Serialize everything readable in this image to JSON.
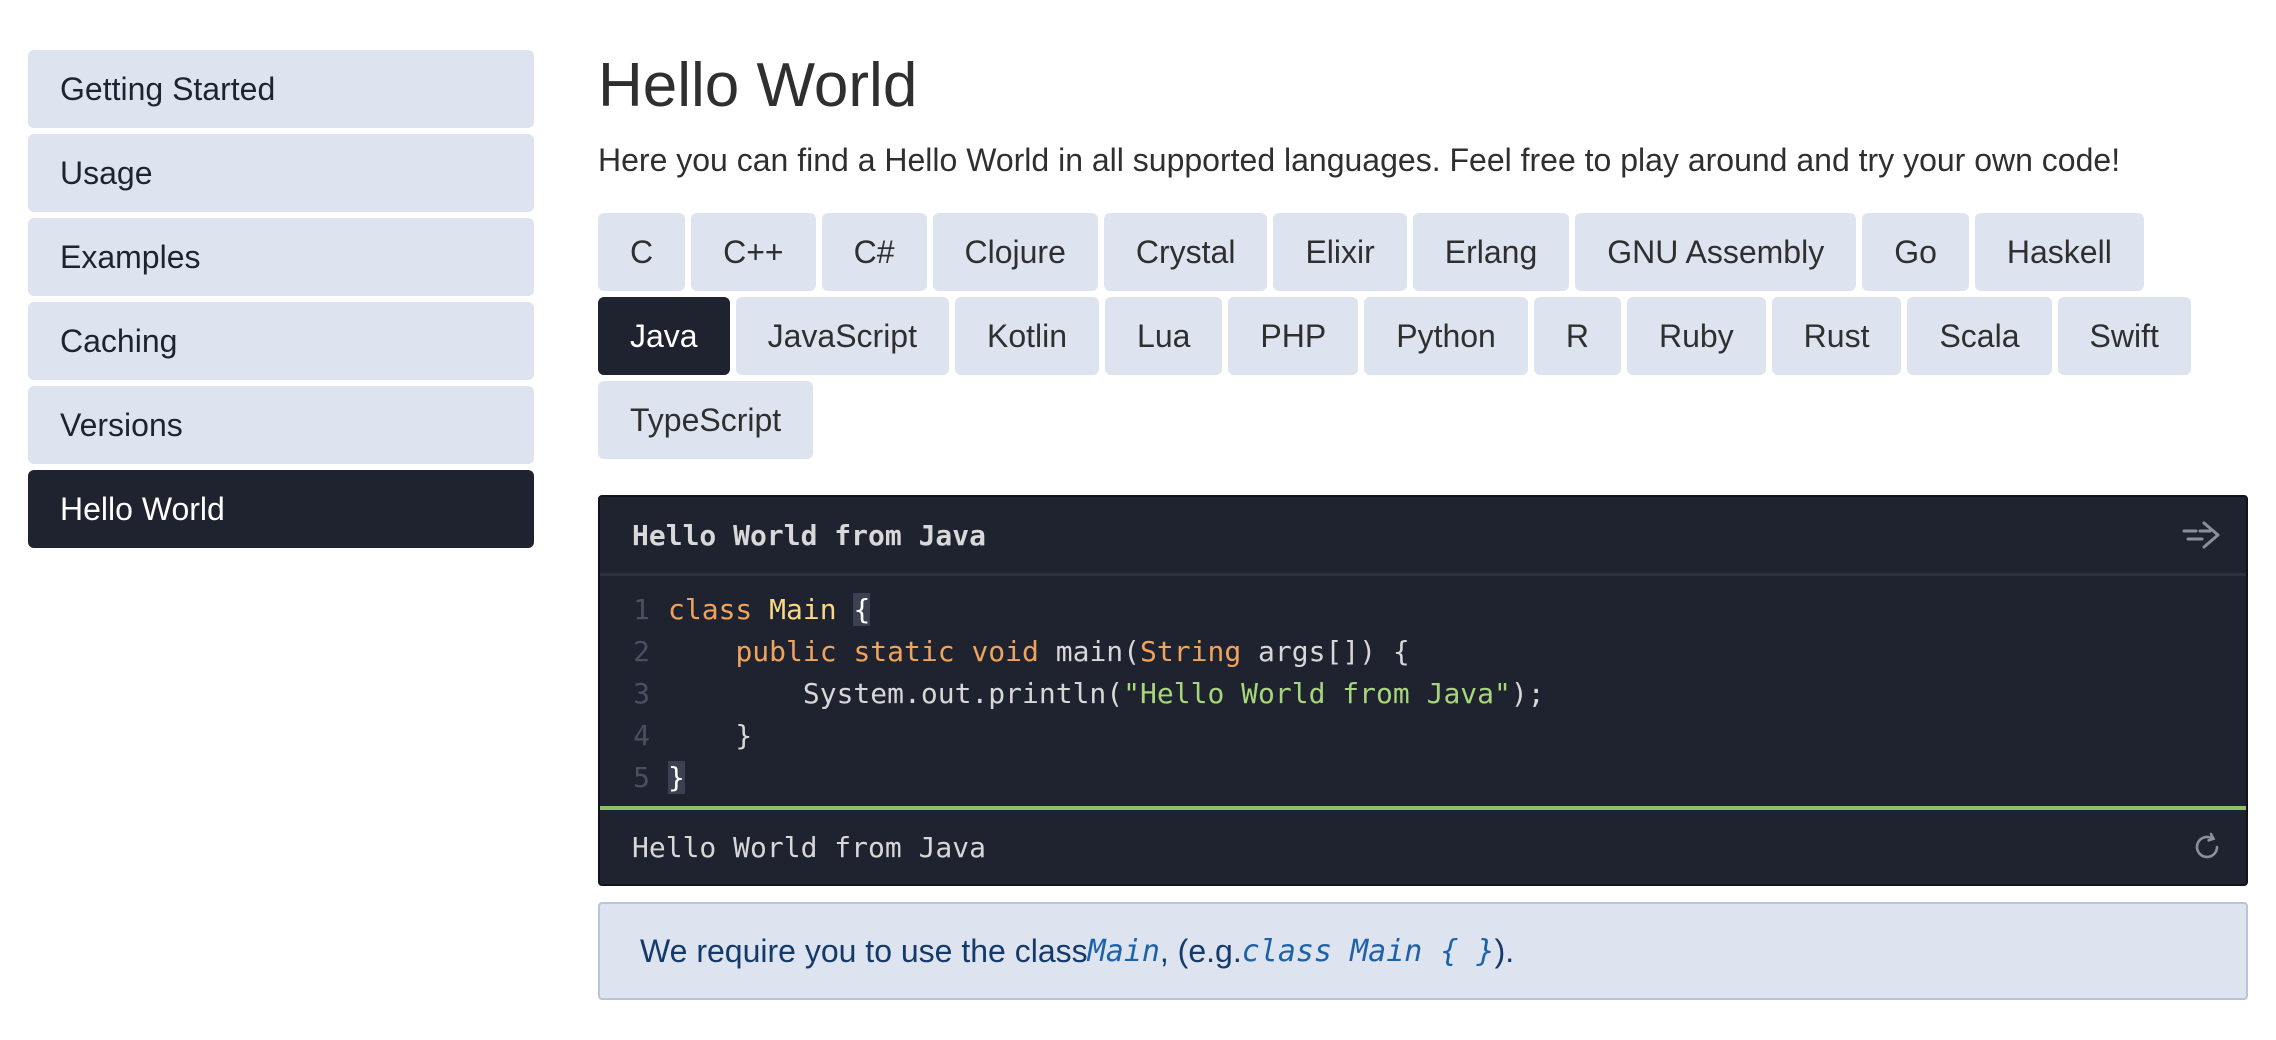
{
  "sidebar": {
    "items": [
      {
        "label": "Getting Started",
        "active": false
      },
      {
        "label": "Usage",
        "active": false
      },
      {
        "label": "Examples",
        "active": false
      },
      {
        "label": "Caching",
        "active": false
      },
      {
        "label": "Versions",
        "active": false
      },
      {
        "label": "Hello World",
        "active": true
      }
    ]
  },
  "main": {
    "title": "Hello World",
    "intro": "Here you can find a Hello World in all supported languages. Feel free to play around and try your own code!",
    "languages": [
      {
        "label": "C",
        "active": false
      },
      {
        "label": "C++",
        "active": false
      },
      {
        "label": "C#",
        "active": false
      },
      {
        "label": "Clojure",
        "active": false
      },
      {
        "label": "Crystal",
        "active": false
      },
      {
        "label": "Elixir",
        "active": false
      },
      {
        "label": "Erlang",
        "active": false
      },
      {
        "label": "GNU Assembly",
        "active": false
      },
      {
        "label": "Go",
        "active": false
      },
      {
        "label": "Haskell",
        "active": false
      },
      {
        "label": "Java",
        "active": true
      },
      {
        "label": "JavaScript",
        "active": false
      },
      {
        "label": "Kotlin",
        "active": false
      },
      {
        "label": "Lua",
        "active": false
      },
      {
        "label": "PHP",
        "active": false
      },
      {
        "label": "Python",
        "active": false
      },
      {
        "label": "R",
        "active": false
      },
      {
        "label": "Ruby",
        "active": false
      },
      {
        "label": "Rust",
        "active": false
      },
      {
        "label": "Scala",
        "active": false
      },
      {
        "label": "Swift",
        "active": false
      },
      {
        "label": "TypeScript",
        "active": false
      }
    ],
    "editor": {
      "title": "Hello World from Java",
      "run_icon": "run-arrow-icon",
      "reset_icon": "refresh-icon",
      "lines": [
        {
          "num": "1",
          "tokens": [
            {
              "t": "class ",
              "c": "kw"
            },
            {
              "t": "Main",
              "c": "cls"
            },
            {
              "t": " ",
              "c": "plain"
            },
            {
              "t": "{",
              "c": "brace-hl"
            }
          ]
        },
        {
          "num": "2",
          "tokens": [
            {
              "t": "    ",
              "c": "plain"
            },
            {
              "t": "public static void ",
              "c": "kw"
            },
            {
              "t": "main(",
              "c": "plain"
            },
            {
              "t": "String",
              "c": "kw"
            },
            {
              "t": " args[]) {",
              "c": "plain"
            }
          ]
        },
        {
          "num": "3",
          "tokens": [
            {
              "t": "        System.out.println(",
              "c": "plain"
            },
            {
              "t": "\"Hello World from Java\"",
              "c": "str"
            },
            {
              "t": ");",
              "c": "plain"
            }
          ]
        },
        {
          "num": "4",
          "tokens": [
            {
              "t": "    }",
              "c": "plain"
            }
          ]
        },
        {
          "num": "5",
          "tokens": [
            {
              "t": "}",
              "c": "brace-hl"
            }
          ]
        }
      ],
      "output": "Hello World from Java"
    },
    "note": {
      "prefix": "We require you to use the class ",
      "class_name": "Main",
      "middle": ", (e.g. ",
      "example": "class Main { }",
      "suffix": ")."
    }
  }
}
